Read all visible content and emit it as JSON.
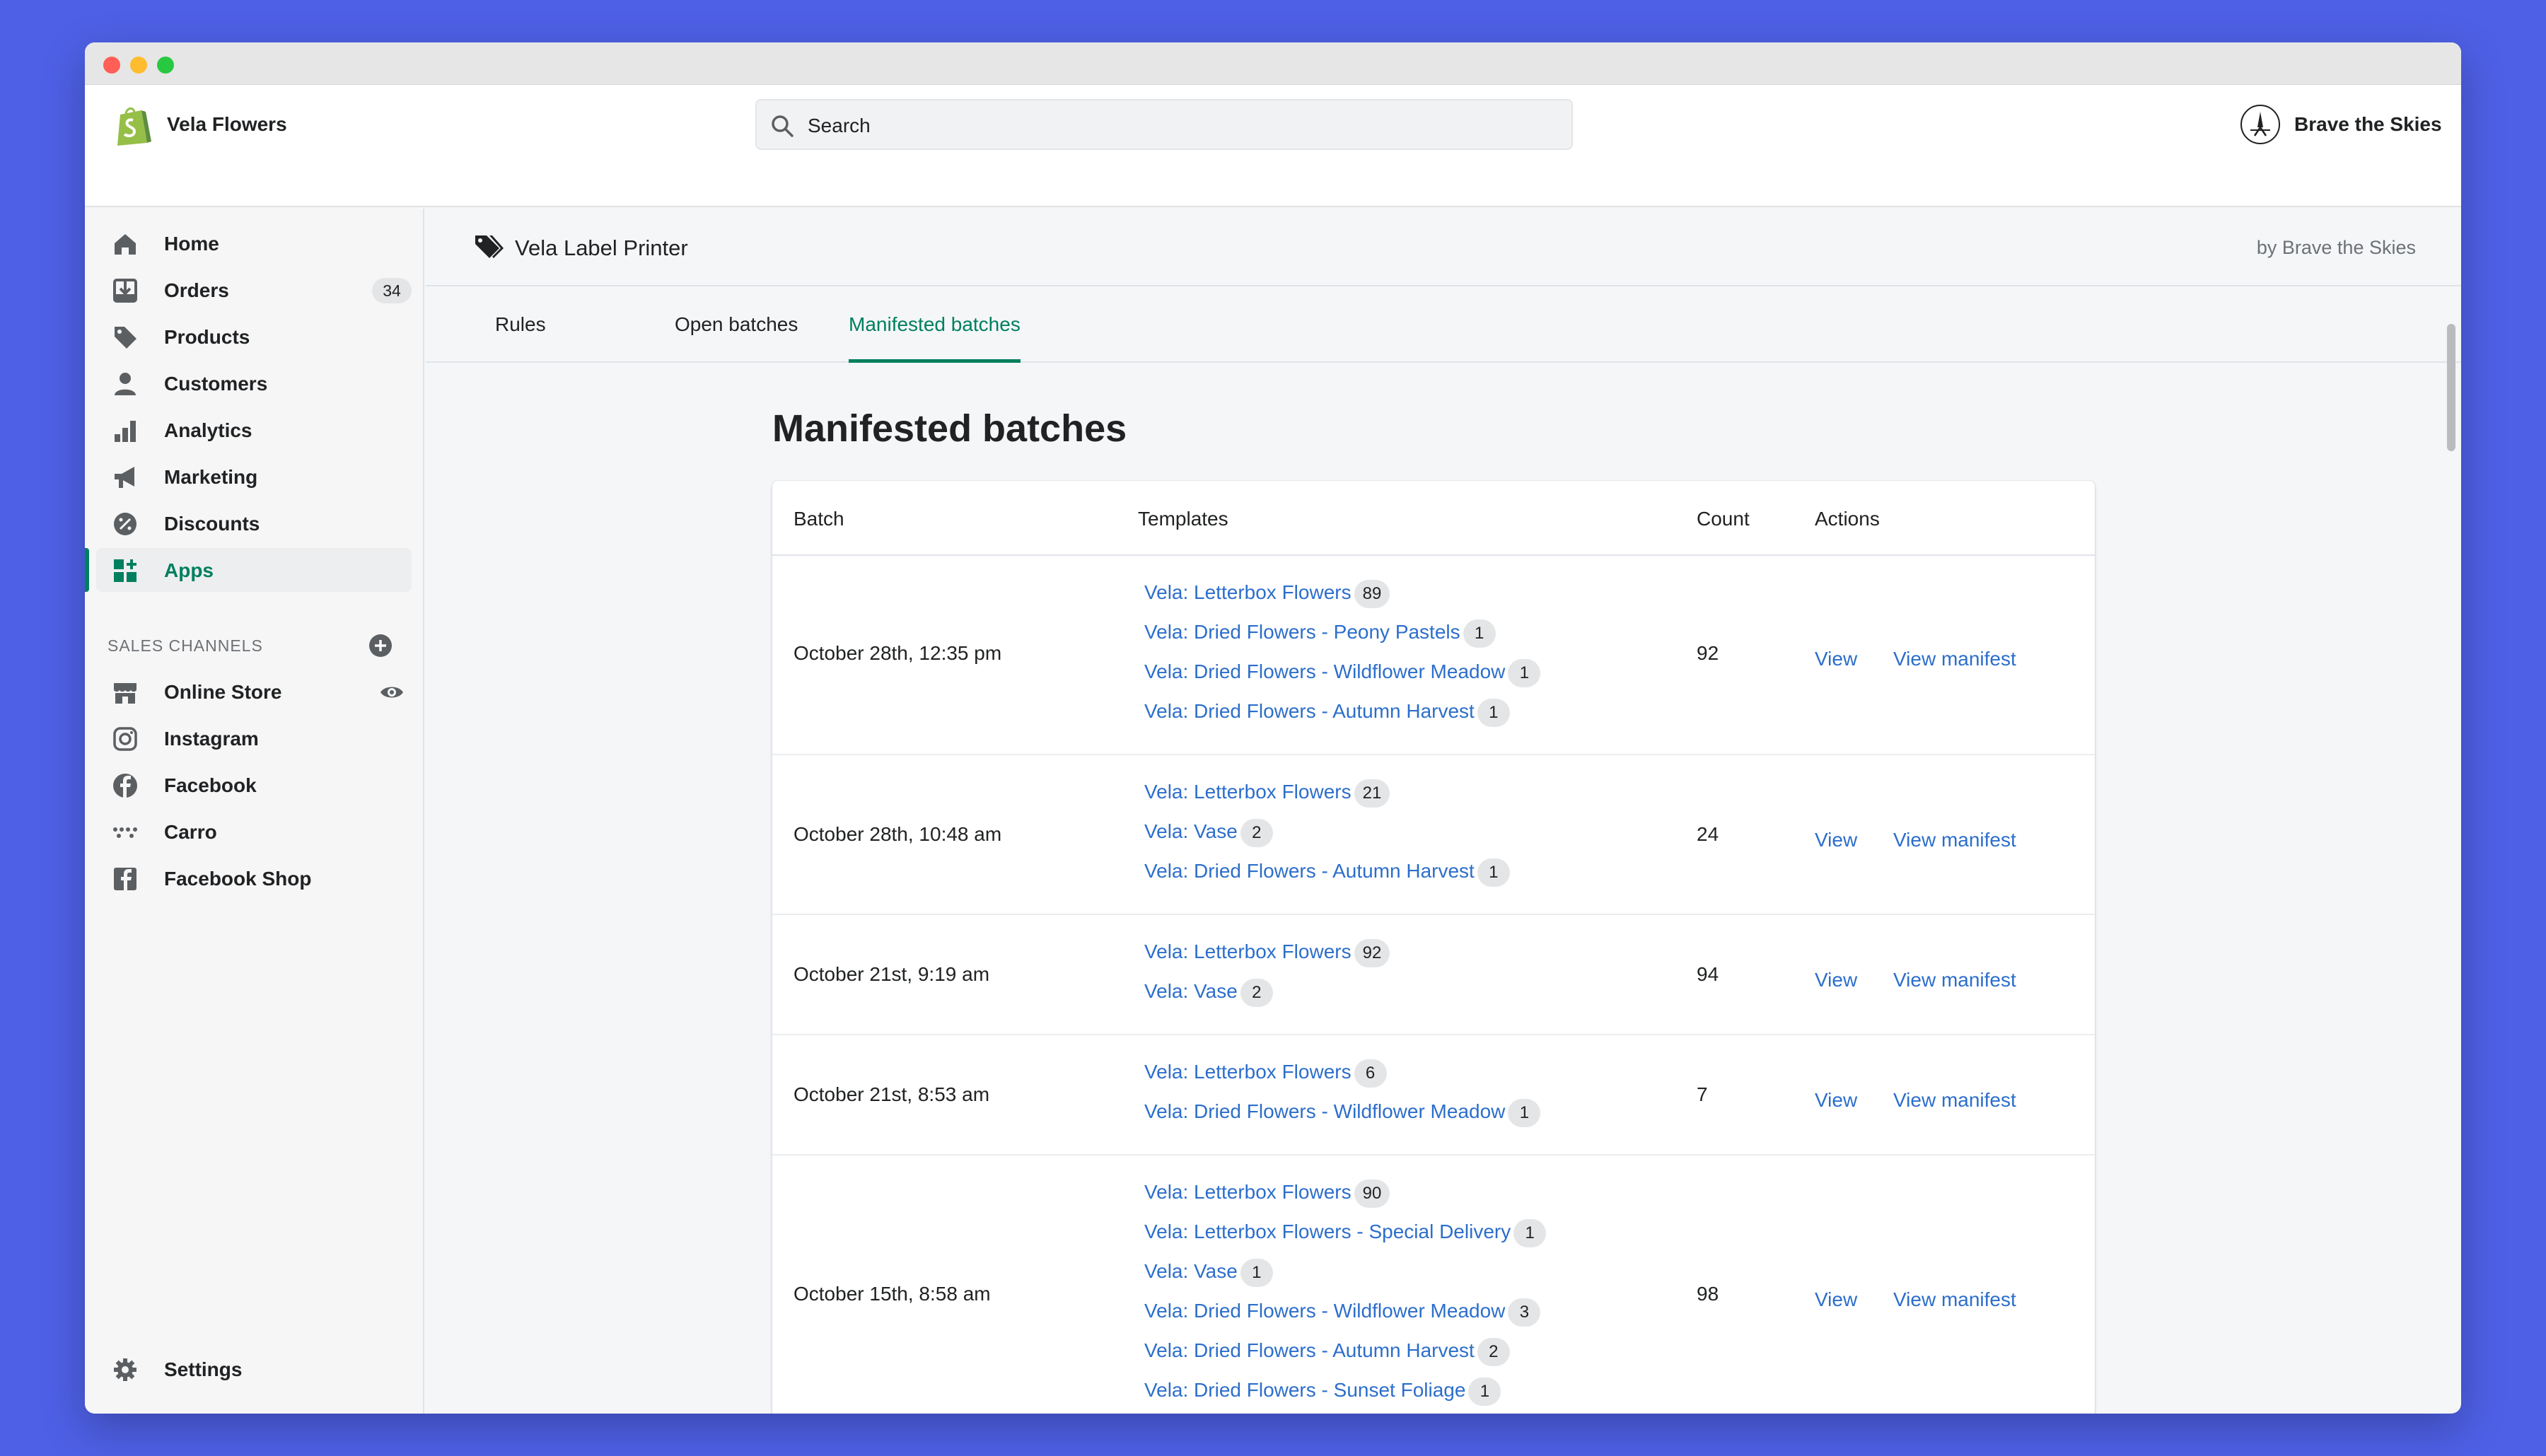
{
  "topbar": {
    "store_name": "Vela Flowers",
    "search_placeholder": "Search",
    "user_name": "Brave the Skies"
  },
  "sidebar": {
    "items": [
      {
        "label": "Home",
        "icon": "home-icon"
      },
      {
        "label": "Orders",
        "icon": "orders-icon",
        "badge": "34"
      },
      {
        "label": "Products",
        "icon": "tag-icon"
      },
      {
        "label": "Customers",
        "icon": "person-icon"
      },
      {
        "label": "Analytics",
        "icon": "bar-chart-icon"
      },
      {
        "label": "Marketing",
        "icon": "megaphone-icon"
      },
      {
        "label": "Discounts",
        "icon": "discount-icon"
      },
      {
        "label": "Apps",
        "icon": "apps-icon"
      }
    ],
    "sales_channels_title": "SALES CHANNELS",
    "channels": [
      {
        "label": "Online Store",
        "icon": "store-icon"
      },
      {
        "label": "Instagram",
        "icon": "instagram-icon"
      },
      {
        "label": "Facebook",
        "icon": "facebook-icon"
      },
      {
        "label": "Carro",
        "icon": "carro-icon"
      },
      {
        "label": "Facebook Shop",
        "icon": "facebook-shop-icon"
      }
    ],
    "settings_label": "Settings"
  },
  "app": {
    "title": "Vela Label Printer",
    "by": "by Brave the Skies",
    "tabs": [
      "Rules",
      "Open batches",
      "Manifested batches"
    ],
    "active_tab": "Manifested batches"
  },
  "page": {
    "title": "Manifested batches"
  },
  "table": {
    "headers": {
      "batch": "Batch",
      "templates": "Templates",
      "count": "Count",
      "actions": "Actions"
    },
    "view_label": "View",
    "view_manifest_label": "View manifest",
    "rows": [
      {
        "batch": "October 28th, 12:35 pm",
        "count": "92",
        "templates": [
          {
            "name": "Vela: Letterbox Flowers",
            "qty": "89"
          },
          {
            "name": "Vela: Dried Flowers - Peony Pastels",
            "qty": "1"
          },
          {
            "name": "Vela: Dried Flowers - Wildflower Meadow",
            "qty": "1"
          },
          {
            "name": "Vela: Dried Flowers - Autumn Harvest",
            "qty": "1"
          }
        ]
      },
      {
        "batch": "October 28th, 10:48 am",
        "count": "24",
        "templates": [
          {
            "name": "Vela: Letterbox Flowers",
            "qty": "21"
          },
          {
            "name": "Vela: Vase",
            "qty": "2"
          },
          {
            "name": "Vela: Dried Flowers - Autumn Harvest",
            "qty": "1"
          }
        ]
      },
      {
        "batch": "October 21st, 9:19 am",
        "count": "94",
        "templates": [
          {
            "name": "Vela: Letterbox Flowers",
            "qty": "92"
          },
          {
            "name": "Vela: Vase",
            "qty": "2"
          }
        ]
      },
      {
        "batch": "October 21st, 8:53 am",
        "count": "7",
        "templates": [
          {
            "name": "Vela: Letterbox Flowers",
            "qty": "6"
          },
          {
            "name": "Vela: Dried Flowers - Wildflower Meadow",
            "qty": "1"
          }
        ]
      },
      {
        "batch": "October 15th, 8:58 am",
        "count": "98",
        "templates": [
          {
            "name": "Vela: Letterbox Flowers",
            "qty": "90"
          },
          {
            "name": "Vela: Letterbox Flowers - Special Delivery",
            "qty": "1"
          },
          {
            "name": "Vela: Vase",
            "qty": "1"
          },
          {
            "name": "Vela: Dried Flowers - Wildflower Meadow",
            "qty": "3"
          },
          {
            "name": "Vela: Dried Flowers - Autumn Harvest",
            "qty": "2"
          },
          {
            "name": "Vela: Dried Flowers - Sunset Foliage",
            "qty": "1"
          }
        ]
      }
    ]
  },
  "colors": {
    "background": "#4e60e6",
    "accent": "#007f5f",
    "link": "#2c6ecb",
    "shopify_green": "#95bf47"
  }
}
